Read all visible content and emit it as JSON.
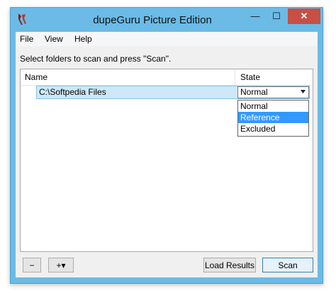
{
  "window": {
    "title": "dupeGuru Picture Edition"
  },
  "menu": {
    "file": "File",
    "view": "View",
    "help": "Help"
  },
  "instructions": "Select folders to scan and press \"Scan\".",
  "list": {
    "headers": {
      "name": "Name",
      "state": "State"
    },
    "rows": [
      {
        "path": "C:\\Softpedia Files",
        "state": "Normal"
      }
    ]
  },
  "dropdown": {
    "options": [
      "Normal",
      "Reference",
      "Excluded"
    ],
    "highlighted": "Reference"
  },
  "buttons": {
    "remove": "−",
    "add": "+▾",
    "load_results": "Load Results",
    "scan": "Scan"
  },
  "icons": {
    "app": "dupeguru-icon",
    "minimize": "minimize-icon",
    "maximize": "maximize-icon",
    "close": "close-icon",
    "chevron": "chevron-down-icon"
  },
  "colors": {
    "title_bar": "#6bbbe6",
    "close_button": "#c74f43",
    "selection": "#3399ff",
    "row_highlight": "#cde8f8"
  }
}
